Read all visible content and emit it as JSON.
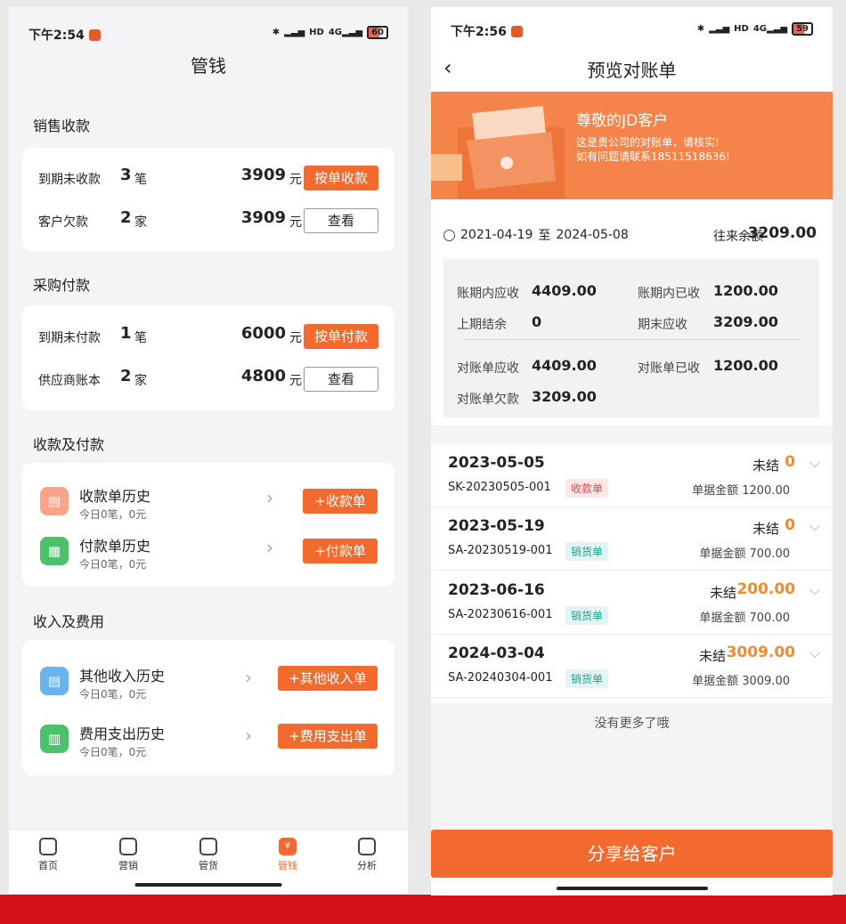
{
  "left": {
    "status": {
      "time": "下午2:54",
      "battery": "60"
    },
    "title": "管钱",
    "sales": {
      "section_title": "销售收款",
      "row1": {
        "label": "到期未收款",
        "count": "3",
        "unit": "笔",
        "amount": "3909",
        "yuan": "元",
        "button": "按单收款"
      },
      "row2": {
        "label": "客户欠款",
        "count": "2",
        "unit": "家",
        "amount": "3909",
        "yuan": "元",
        "button": "查看"
      }
    },
    "purchase": {
      "section_title": "采购付款",
      "row1": {
        "label": "到期未付款",
        "count": "1",
        "unit": "笔",
        "amount": "6000",
        "yuan": "元",
        "button": "按单付款"
      },
      "row2": {
        "label": "供应商账本",
        "count": "2",
        "unit": "家",
        "amount": "4800",
        "yuan": "元",
        "button": "查看"
      }
    },
    "receipts": {
      "section_title": "收款及付款",
      "items": [
        {
          "title": "收款单历史",
          "sub": "今日0笔，0元",
          "button": "+收款单"
        },
        {
          "title": "付款单历史",
          "sub": "今日0笔，0元",
          "button": "+付款单"
        }
      ]
    },
    "income": {
      "section_title": "收入及费用",
      "items": [
        {
          "title": "其他收入历史",
          "sub": "今日0笔，0元",
          "button": "+其他收入单"
        },
        {
          "title": "费用支出历史",
          "sub": "今日0笔，0元",
          "button": "+费用支出单"
        }
      ]
    },
    "tabs": [
      {
        "label": "首页"
      },
      {
        "label": "营销"
      },
      {
        "label": "管货"
      },
      {
        "label": "管钱"
      },
      {
        "label": "分析"
      }
    ],
    "active_tab_glyph": "¥"
  },
  "right": {
    "status": {
      "time": "下午2:56",
      "battery": "59"
    },
    "title": "预览对账单",
    "banner": {
      "greeting": "尊敬的JD客户",
      "line1": "这是贵公司的对账单，请核实!",
      "line2": "如有问题请联系18511518636!"
    },
    "period": {
      "start": "2021-04-19",
      "to": "至",
      "end": "2024-05-08"
    },
    "balance": {
      "label": "往来余额",
      "value": "3209.00"
    },
    "summary": {
      "period_receivable": {
        "label": "账期内应收",
        "value": "4409.00"
      },
      "period_received": {
        "label": "账期内已收",
        "value": "1200.00"
      },
      "prev_balance": {
        "label": "上期结余",
        "value": "0"
      },
      "end_receivable": {
        "label": "期末应收",
        "value": "3209.00"
      },
      "stmt_receivable": {
        "label": "对账单应收",
        "value": "4409.00"
      },
      "stmt_received": {
        "label": "对账单已收",
        "value": "1200.00"
      },
      "stmt_owed": {
        "label": "对账单欠款",
        "value": "3209.00"
      }
    },
    "entries": [
      {
        "date": "2023-05-05",
        "status": "未结",
        "value": "0",
        "no": "SK-20230505-001",
        "tag": "收款单",
        "amount": "单据金额 1200.00"
      },
      {
        "date": "2023-05-19",
        "status": "未结",
        "value": "0",
        "no": "SA-20230519-001",
        "tag": "销货单",
        "amount": "单据金额 700.00"
      },
      {
        "date": "2023-06-16",
        "status": "未结",
        "value": "200.00",
        "no": "SA-20230616-001",
        "tag": "销货单",
        "amount": "单据金额 700.00"
      },
      {
        "date": "2024-03-04",
        "status": "未结",
        "value": "3009.00",
        "no": "SA-20240304-001",
        "tag": "销货单",
        "amount": "单据金额 3009.00"
      }
    ],
    "no_more": "没有更多了哦",
    "share_button": "分享给客户"
  },
  "colors": {
    "accent": "#f26a2e",
    "banner": "#f6844a",
    "status_value": "#f28a2e",
    "bottom_bar": "#d5121b"
  }
}
